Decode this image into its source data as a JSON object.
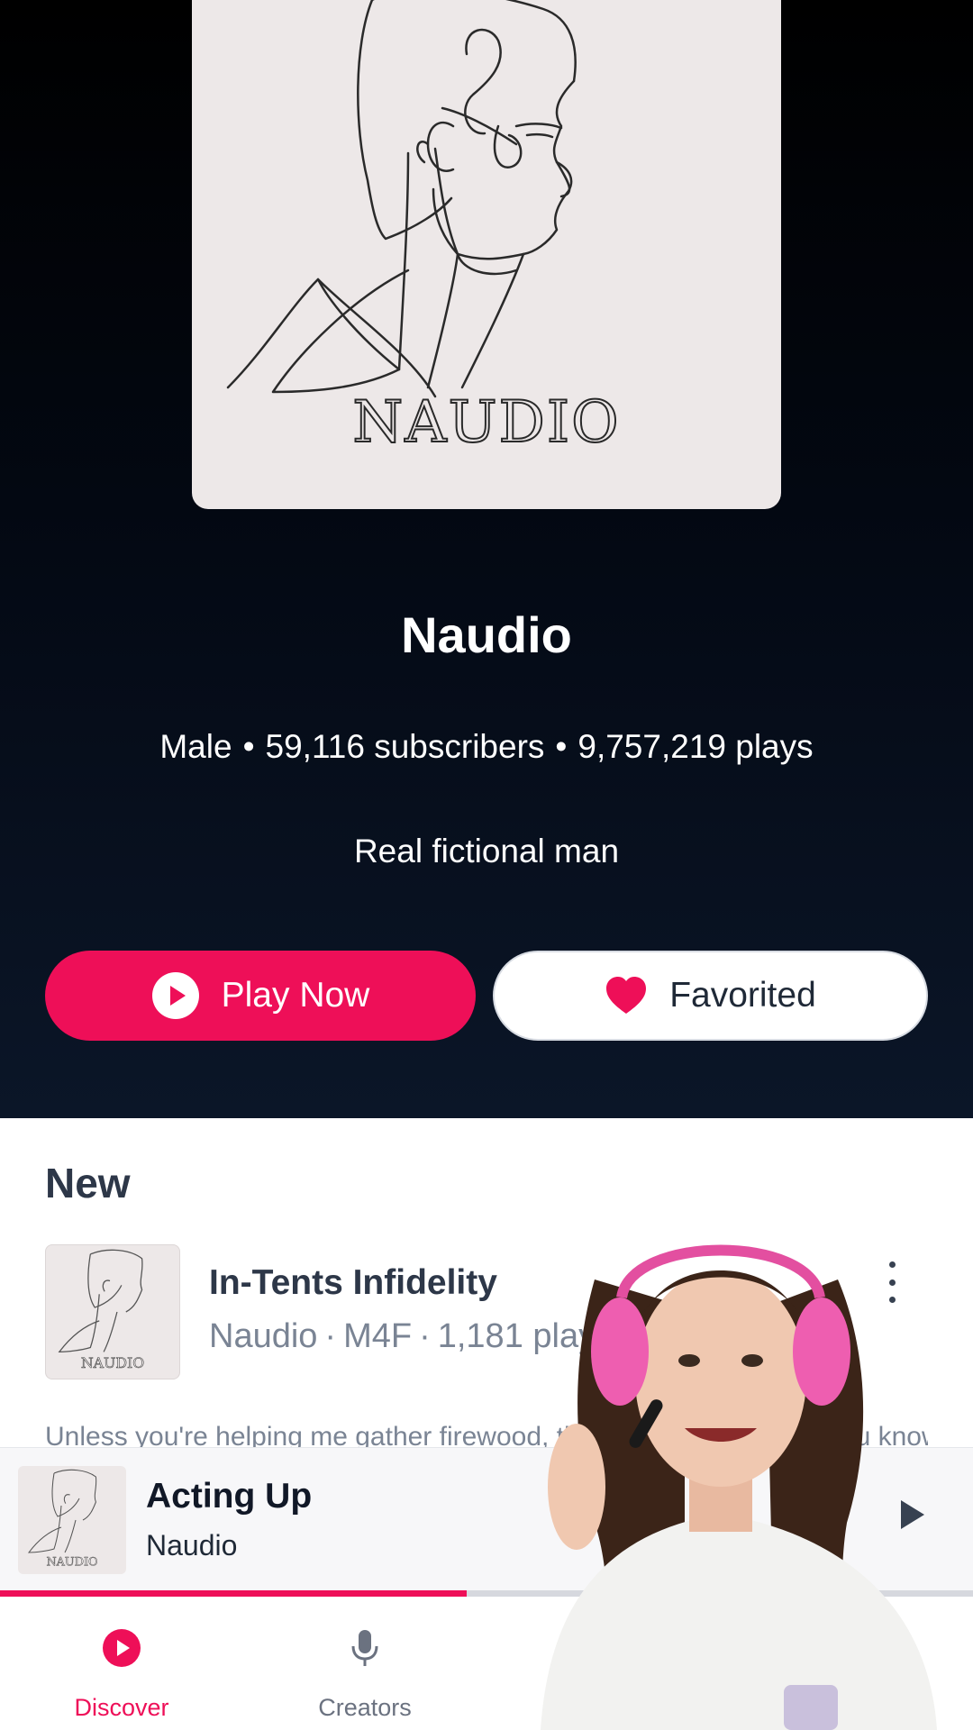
{
  "cover": {
    "logo_text": "NAUDIO"
  },
  "creator": {
    "name": "Naudio",
    "gender": "Male",
    "subscribers": "59,116 subscribers",
    "plays": "9,757,219 plays",
    "tagline": "Real fictional man"
  },
  "actions": {
    "play_label": "Play Now",
    "play_icon": "play-circle-icon",
    "favorite_label": "Favorited",
    "favorite_icon": "heart-icon"
  },
  "new_section": {
    "title": "New",
    "episode": {
      "title": "In-Tents Infidelity",
      "creator": "Naudio",
      "category": "M4F",
      "plays": "1,181 plays",
      "description": "Unless you're helping me gather firewood, then you should just... you know... I would..."
    }
  },
  "now_playing": {
    "title": "Acting Up",
    "artist": "Naudio",
    "progress": 0.48
  },
  "tabs": [
    {
      "label": "Discover",
      "icon": "play-circle-icon",
      "active": true
    },
    {
      "label": "Creators",
      "icon": "microphone-icon",
      "active": false
    }
  ],
  "colors": {
    "accent": "#ee0f58",
    "hero_top": "#000000",
    "hero_bottom": "#0b1628",
    "cover_bg": "#ede8e8"
  }
}
